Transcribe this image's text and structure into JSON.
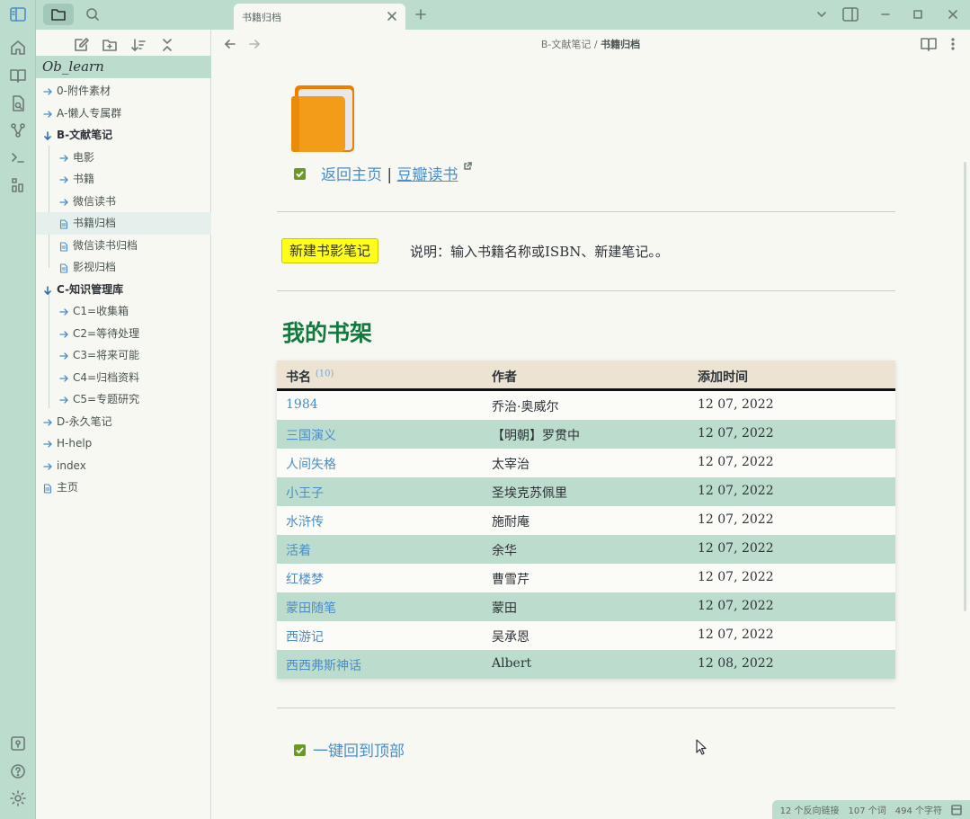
{
  "tabs": [
    {
      "label": "书籍归档"
    }
  ],
  "breadcrumb": {
    "folder": "B-文献笔记",
    "sep": "/",
    "current": "书籍归档"
  },
  "vault": {
    "name": "Ob_learn"
  },
  "tree": [
    {
      "label": "0-附件素材",
      "type": "folder",
      "level": 0
    },
    {
      "label": "A-懒人专属群",
      "type": "folder",
      "level": 0
    },
    {
      "label": "B-文献笔记",
      "type": "folder-open",
      "level": 0
    },
    {
      "label": "电影",
      "type": "folder",
      "level": 1
    },
    {
      "label": "书籍",
      "type": "folder",
      "level": 1
    },
    {
      "label": "微信读书",
      "type": "folder",
      "level": 1
    },
    {
      "label": "书籍归档",
      "type": "file",
      "level": 1,
      "active": true
    },
    {
      "label": "微信读书归档",
      "type": "file",
      "level": 1
    },
    {
      "label": "影视归档",
      "type": "file",
      "level": 1
    },
    {
      "label": "C-知识管理库",
      "type": "folder-open",
      "level": 0
    },
    {
      "label": "C1=收集箱",
      "type": "folder",
      "level": 1
    },
    {
      "label": "C2=等待处理",
      "type": "folder",
      "level": 1
    },
    {
      "label": "C3=将来可能",
      "type": "folder",
      "level": 1
    },
    {
      "label": "C4=归档资料",
      "type": "folder",
      "level": 1
    },
    {
      "label": "C5=专题研究",
      "type": "folder",
      "level": 1
    },
    {
      "label": "D-永久笔记",
      "type": "folder",
      "level": 0
    },
    {
      "label": "H-help",
      "type": "folder",
      "level": 0
    },
    {
      "label": "index",
      "type": "folder",
      "level": 0
    },
    {
      "label": "主页",
      "type": "file",
      "level": 0
    }
  ],
  "content": {
    "back_link": "返回主页",
    "pipe": "|",
    "douban_link": "豆瓣读书",
    "new_button": "新建书影笔记",
    "description": "说明：输入书籍名称或ISBN、新建笔记。。",
    "heading": "我的书架",
    "table": {
      "headers": [
        "书名",
        "作者",
        "添加时间"
      ],
      "count": "(10)",
      "rows": [
        {
          "title": "1984",
          "author": "乔治·奥威尔",
          "date": "12 07, 2022"
        },
        {
          "title": "三国演义",
          "author": "【明朝】罗贯中",
          "date": "12 07, 2022"
        },
        {
          "title": "人间失格",
          "author": "太宰治",
          "date": "12 07, 2022"
        },
        {
          "title": "小王子",
          "author": "圣埃克苏佩里",
          "date": "12 07, 2022"
        },
        {
          "title": "水浒传",
          "author": "施耐庵",
          "date": "12 07, 2022"
        },
        {
          "title": "活着",
          "author": "余华",
          "date": "12 07, 2022"
        },
        {
          "title": "红楼梦",
          "author": "曹雪芹",
          "date": "12 07, 2022"
        },
        {
          "title": "蒙田随笔",
          "author": "蒙田",
          "date": "12 07, 2022"
        },
        {
          "title": "西游记",
          "author": "吴承恩",
          "date": "12 07, 2022"
        },
        {
          "title": "西西弗斯神话",
          "author": "Albert",
          "date": "12 08, 2022"
        }
      ]
    },
    "back_top": "一键回到顶部"
  },
  "status": {
    "backlinks": "12 个反向链接",
    "words": "107 个词",
    "chars": "494 个字符"
  },
  "colors": {
    "accent": "#bcdccd",
    "link": "#4c8dc5",
    "heading": "#137a3f",
    "highlight": "#ffff1a"
  }
}
